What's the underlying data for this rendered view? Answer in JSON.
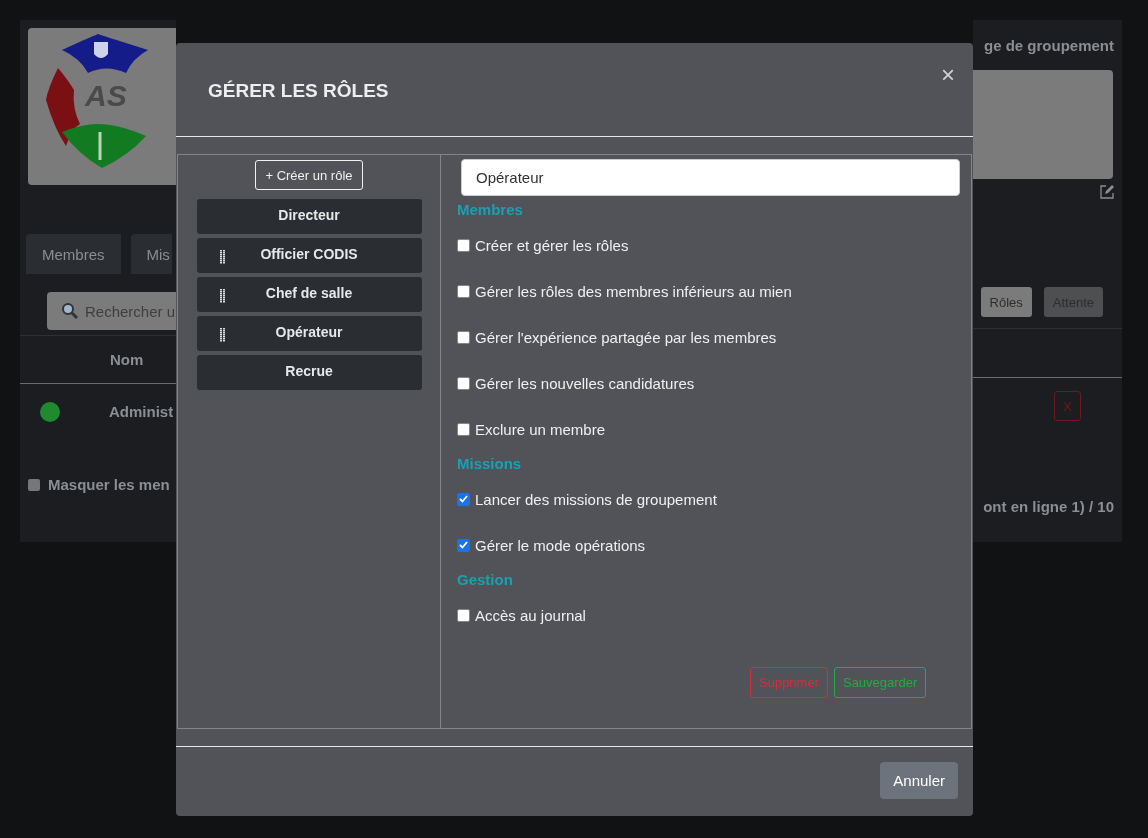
{
  "background": {
    "logo_text": "AS",
    "heading": "ge de groupement",
    "tabs": [
      {
        "label": "Membres"
      },
      {
        "label": "Mis"
      }
    ],
    "search": {
      "placeholder": "Rechercher u"
    },
    "filters": [
      {
        "label": "Rôles",
        "selected": true
      },
      {
        "label": "Attente",
        "selected": false
      }
    ],
    "table": {
      "columns": [
        "Nom"
      ],
      "rows": [
        {
          "color": "#1f8a2e",
          "name": "Administ",
          "remove": "X"
        }
      ]
    },
    "hide_members": {
      "label": "Masquer les men",
      "checked": false
    },
    "footer": "ont en ligne 1) / 10"
  },
  "modal": {
    "title": "GÉRER LES RÔLES",
    "close": "×",
    "create_button": "+ Créer un rôle",
    "roles": [
      {
        "name": "Directeur",
        "draggable": false
      },
      {
        "name": "Officier CODIS",
        "draggable": true
      },
      {
        "name": "Chef de salle",
        "draggable": true
      },
      {
        "name": "Opérateur",
        "draggable": true
      },
      {
        "name": "Recrue",
        "draggable": false
      }
    ],
    "role_name": "Opérateur",
    "sections": [
      {
        "title": "Membres",
        "permissions": [
          {
            "label": "Créer et gérer les rôles",
            "checked": false
          },
          {
            "label": "Gérer les rôles des membres inférieurs au mien",
            "checked": false
          },
          {
            "label": "Gérer l'expérience partagée par les membres",
            "checked": false
          },
          {
            "label": "Gérer les nouvelles candidatures",
            "checked": false
          },
          {
            "label": "Exclure un membre",
            "checked": false
          }
        ]
      },
      {
        "title": "Missions",
        "permissions": [
          {
            "label": "Lancer des missions de groupement",
            "checked": true
          },
          {
            "label": "Gérer le mode opérations",
            "checked": true
          }
        ]
      },
      {
        "title": "Gestion",
        "permissions": [
          {
            "label": "Accès au journal",
            "checked": false
          }
        ]
      }
    ],
    "delete_button": "Supprimer",
    "save_button": "Sauvegarder",
    "cancel_button": "Annuler"
  }
}
